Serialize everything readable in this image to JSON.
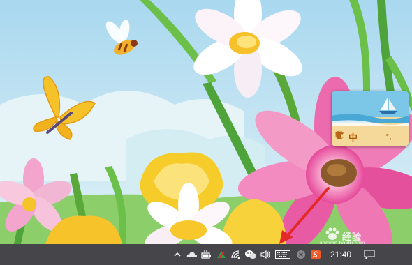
{
  "desktop": {
    "wallpaper": "flowers-and-butterflies",
    "colors": {
      "sky": "#bfe3f3",
      "pink_flower": "#e8559a",
      "yellow_flower": "#f6cc2a",
      "stem": "#5aa83a"
    }
  },
  "ime_widget": {
    "language": "中",
    "punct": "°,",
    "icons": [
      "moon-icon",
      "shirt-icon"
    ],
    "theme": "beach"
  },
  "taskbar": {
    "background": "#46454a",
    "tray_icons": [
      "show-hidden-icons-chevron",
      "onedrive-cloud-icon",
      "battery-plug-icon",
      "network-alert-icon",
      "wifi-icon",
      "wechat-icon",
      "volume-icon",
      "keyboard-icon",
      "close-circle-icon",
      "sogou-s-icon"
    ],
    "clock": "21:40",
    "notification": "action-center-icon"
  },
  "annotation": {
    "arrow_color": "#e32a2a",
    "points_to": "volume-icon"
  },
  "watermark": {
    "text": "经验",
    "url": "jingyan.baidu.com"
  }
}
